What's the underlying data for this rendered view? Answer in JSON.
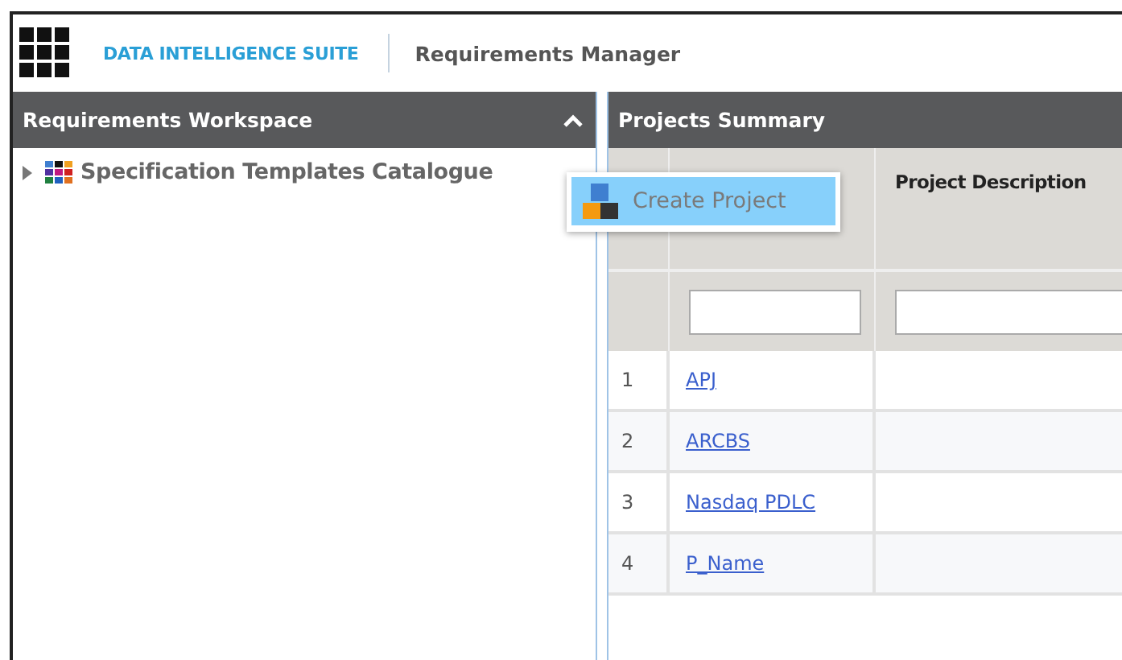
{
  "app": {
    "name": "DATA INTELLIGENCE SUITE",
    "module": "Requirements Manager"
  },
  "workspace": {
    "title": "Requirements Workspace",
    "collapsed": false,
    "tree": [
      {
        "label": "Specification Templates Catalogue",
        "expanded": false
      }
    ]
  },
  "projects": {
    "title": "Projects Summary",
    "columns": [
      "Project Description"
    ],
    "rows": [
      {
        "number": "1",
        "name": "APJ"
      },
      {
        "number": "2",
        "name": "ARCBS"
      },
      {
        "number": "3",
        "name": "Nasdaq PDLC"
      },
      {
        "number": "4",
        "name": "P_Name"
      }
    ]
  },
  "context_menu": {
    "items": [
      {
        "label": "Create Project",
        "highlighted": true
      }
    ]
  }
}
